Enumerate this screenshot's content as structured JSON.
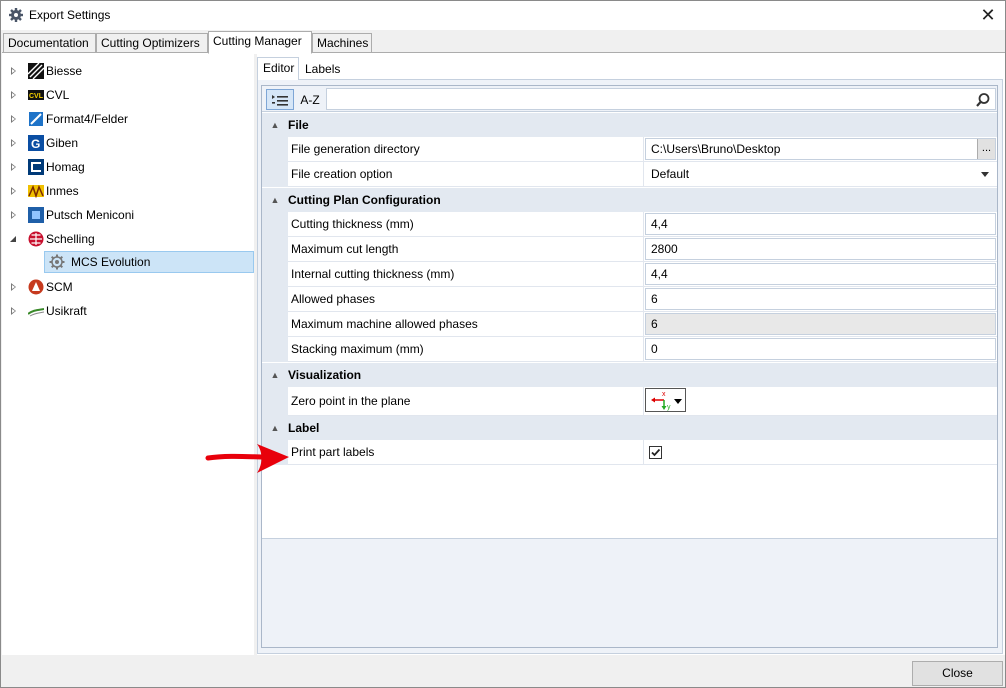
{
  "window": {
    "title": "Export Settings",
    "close_glyph": "✕"
  },
  "main_tabs": [
    {
      "label": "Documentation"
    },
    {
      "label": "Cutting Optimizers"
    },
    {
      "label": "Cutting Manager",
      "active": true
    },
    {
      "label": "Machines"
    }
  ],
  "tree": [
    {
      "label": "Biesse",
      "icon": "biesse-icon",
      "expand": "collapsed"
    },
    {
      "label": "CVL",
      "icon": "cvl-icon",
      "icon_text": "CVL",
      "expand": "collapsed"
    },
    {
      "label": "Format4/Felder",
      "icon": "format4-icon",
      "expand": "collapsed"
    },
    {
      "label": "Giben",
      "icon": "giben-icon",
      "icon_text": "G",
      "expand": "collapsed"
    },
    {
      "label": "Homag",
      "icon": "homag-icon",
      "expand": "collapsed"
    },
    {
      "label": "Inmes",
      "icon": "inmes-icon",
      "expand": "collapsed"
    },
    {
      "label": "Putsch Meniconi",
      "icon": "putsch-icon",
      "expand": "collapsed"
    },
    {
      "label": "Schelling",
      "icon": "schelling-icon",
      "expand": "expanded"
    },
    {
      "label": "MCS Evolution",
      "icon": "gear-icon",
      "expand": "none",
      "selected": true
    },
    {
      "label": "SCM",
      "icon": "scm-icon",
      "expand": "collapsed"
    },
    {
      "label": "Usikraft",
      "icon": "usikraft-icon",
      "expand": "collapsed"
    }
  ],
  "sub_tabs": [
    {
      "label": "Editor",
      "active": true
    },
    {
      "label": "Labels"
    }
  ],
  "toolbar": {
    "categorized_icon": "categorized-icon",
    "az_label": "A-Z",
    "search_placeholder": "",
    "search_icon": "search-icon"
  },
  "categories": {
    "file": {
      "title": "File",
      "generation_dir_label": "File generation directory",
      "generation_dir_value": "C:\\Users\\Bruno\\Desktop",
      "browse_label": "...",
      "creation_option_label": "File creation option",
      "creation_option_value": "Default"
    },
    "cutting": {
      "title": "Cutting Plan Configuration",
      "rows": [
        {
          "label": "Cutting thickness (mm)",
          "value": "4,4"
        },
        {
          "label": "Maximum cut length",
          "value": "2800"
        },
        {
          "label": "Internal cutting thickness (mm)",
          "value": "4,4"
        },
        {
          "label": "Allowed phases",
          "value": "6"
        },
        {
          "label": "Maximum machine allowed phases",
          "value": "6",
          "readonly": true
        },
        {
          "label": "Stacking maximum (mm)",
          "value": "0"
        }
      ]
    },
    "visualization": {
      "title": "Visualization",
      "zero_point_label": "Zero point in the plane",
      "zero_point_icon": "zero-point-axes-icon",
      "axis_x_label": "x",
      "axis_y_label": "y"
    },
    "label": {
      "title": "Label",
      "print_labels_label": "Print part labels",
      "print_labels_checked": true
    }
  },
  "annotation": {
    "icon": "red-arrow-icon",
    "color": "#e8000b"
  },
  "footer": {
    "close_label": "Close"
  }
}
